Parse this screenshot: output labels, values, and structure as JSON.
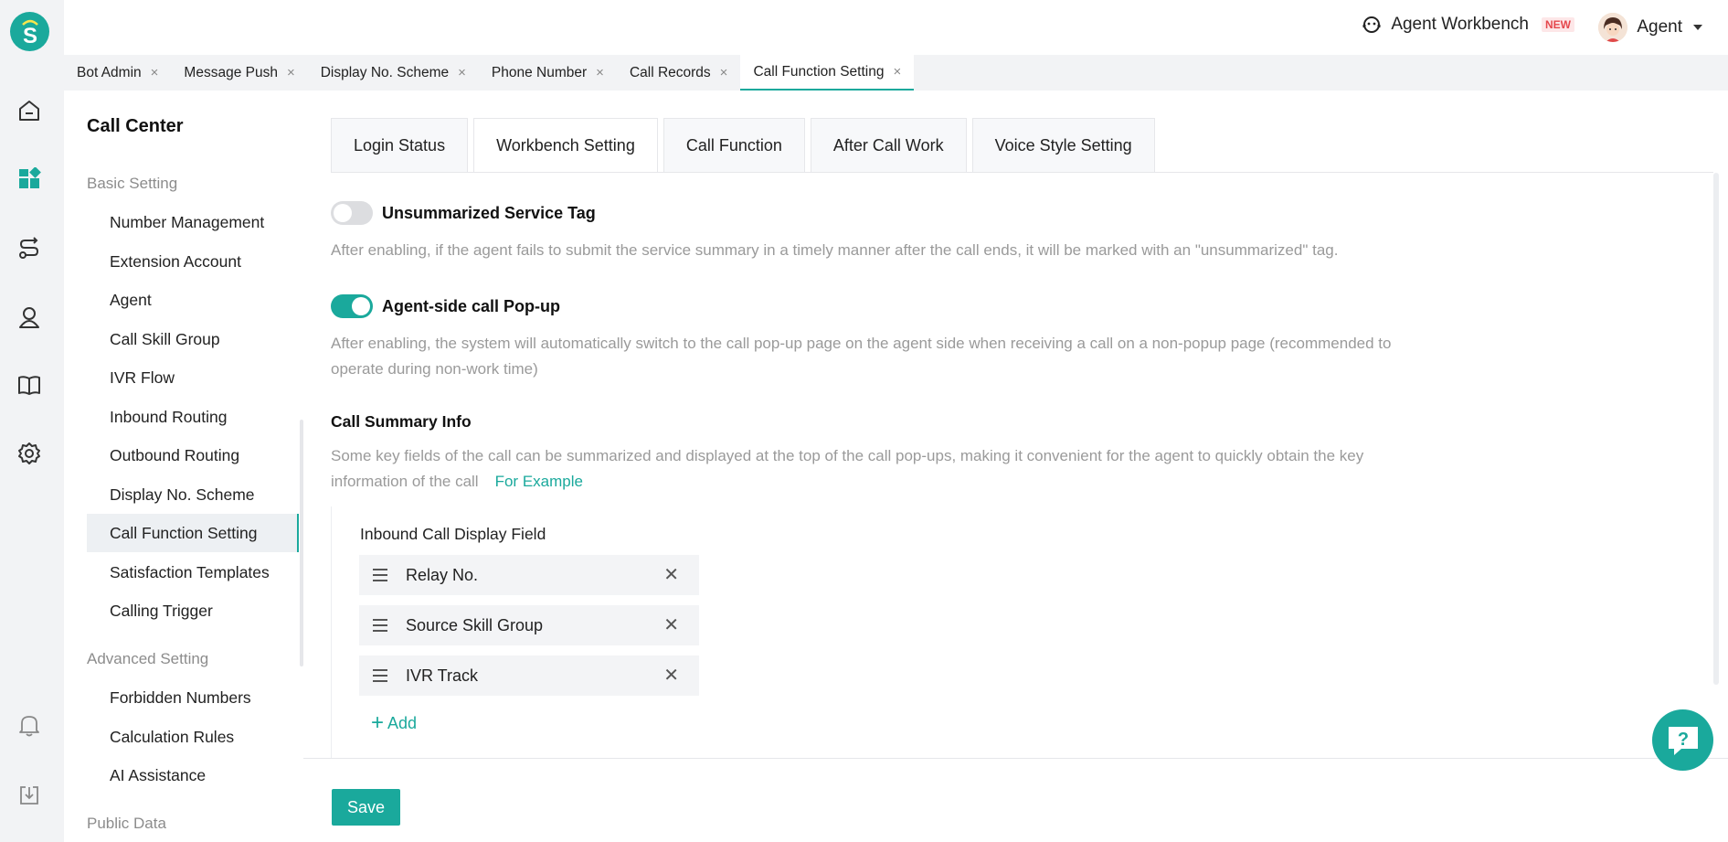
{
  "header": {
    "workbench_label": "Agent Workbench",
    "new_badge": "NEW",
    "user_label": "Agent"
  },
  "page_tabs": [
    {
      "label": "Bot Admin",
      "close": "×"
    },
    {
      "label": "Message Push",
      "close": "×"
    },
    {
      "label": "Display No. Scheme",
      "close": "×"
    },
    {
      "label": "Phone Number",
      "close": "×"
    },
    {
      "label": "Call Records",
      "close": "×"
    },
    {
      "label": "Call Function Setting",
      "close": "×",
      "active": true
    }
  ],
  "sidebar": {
    "title": "Call Center",
    "groups": {
      "basic": "Basic Setting",
      "advanced": "Advanced Setting",
      "public": "Public Data"
    },
    "basic_items": [
      "Number Management",
      "Extension Account",
      "Agent",
      "Call Skill Group",
      "IVR Flow",
      "Inbound Routing",
      "Outbound Routing",
      "Display No. Scheme",
      "Call Function Setting",
      "Satisfaction Templates",
      "Calling Trigger"
    ],
    "advanced_items": [
      "Forbidden Numbers",
      "Calculation Rules",
      "AI Assistance"
    ],
    "active_item": "Call Function Setting"
  },
  "content_tabs": [
    "Login Status",
    "Workbench Setting",
    "Call Function",
    "After Call Work",
    "Voice Style Setting"
  ],
  "active_content_tab": "Workbench Setting",
  "settings": {
    "unsummarized": {
      "title": "Unsummarized Service Tag",
      "enabled": false,
      "desc": "After enabling, if the agent fails to submit the service summary in a timely manner after the call ends, it will be marked with an \"unsummarized\" tag."
    },
    "popup": {
      "title": "Agent-side call Pop-up",
      "enabled": true,
      "desc": "After enabling, the system will automatically switch to the call pop-up page on the agent side when receiving a call on a non-popup page (recommended to operate during non-work time)"
    },
    "summary": {
      "title": "Call Summary Info",
      "desc": "Some key fields of the call can be summarized and displayed at the top of the call pop-ups, making it convenient for the agent to quickly obtain the key information of the call",
      "example_link": "For Example",
      "inbound_label": "Inbound Call Display Field",
      "fields": [
        "Relay No.",
        "Source Skill Group",
        "IVR Track"
      ],
      "add_label": "Add"
    }
  },
  "footer": {
    "save_label": "Save"
  },
  "colors": {
    "accent": "#1aa99c",
    "new_badge": "#e5484d"
  }
}
